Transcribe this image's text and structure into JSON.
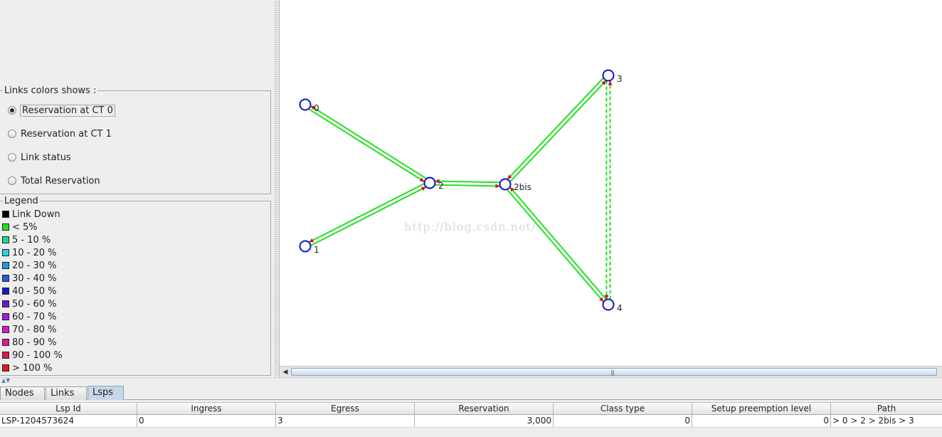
{
  "links_colors": {
    "title": "Links colors shows :",
    "options": [
      {
        "label": "Reservation at CT 0",
        "checked": true
      },
      {
        "label": "Reservation at CT 1",
        "checked": false
      },
      {
        "label": "Link status",
        "checked": false
      },
      {
        "label": "Total Reservation",
        "checked": false
      }
    ]
  },
  "legend": {
    "title": "Legend",
    "items": [
      {
        "label": "Link Down",
        "color": "#000000"
      },
      {
        "label": "< 5%",
        "color": "#22e022"
      },
      {
        "label": "5 - 10 %",
        "color": "#1fd890"
      },
      {
        "label": "10 - 20 %",
        "color": "#22d8e6"
      },
      {
        "label": "20 - 30 %",
        "color": "#1e9ae0"
      },
      {
        "label": "30 - 40 %",
        "color": "#1a5ee6"
      },
      {
        "label": "40 - 50 %",
        "color": "#1818c8"
      },
      {
        "label": "50 - 60 %",
        "color": "#6a18d8"
      },
      {
        "label": "60 - 70 %",
        "color": "#a818e0"
      },
      {
        "label": "70 - 80 %",
        "color": "#d818d0"
      },
      {
        "label": "80 - 90 %",
        "color": "#e0189a"
      },
      {
        "label": "90 - 100 %",
        "color": "#e01850"
      },
      {
        "label": "> 100 %",
        "color": "#e81818"
      }
    ]
  },
  "graph": {
    "node_color": "#1010d0",
    "link_color": "#22e022",
    "arrow_color": "#d01010",
    "nodes": [
      {
        "id": "0",
        "label": "0"
      },
      {
        "id": "1",
        "label": "1"
      },
      {
        "id": "2",
        "label": "2"
      },
      {
        "id": "2bis",
        "label": "2bis"
      },
      {
        "id": "3",
        "label": "3"
      },
      {
        "id": "4",
        "label": "4"
      }
    ],
    "links": [
      {
        "from": "0",
        "to": "2",
        "style": "solid"
      },
      {
        "from": "1",
        "to": "2",
        "style": "solid"
      },
      {
        "from": "2",
        "to": "2bis",
        "style": "solid"
      },
      {
        "from": "2bis",
        "to": "3",
        "style": "solid"
      },
      {
        "from": "2bis",
        "to": "4",
        "style": "solid"
      },
      {
        "from": "3",
        "to": "4",
        "style": "dashed"
      }
    ],
    "watermark": "http://blog.csdn.net/"
  },
  "tabs": [
    "Nodes",
    "Links",
    "Lsps"
  ],
  "active_tab": "Lsps",
  "table": {
    "columns": [
      "Lsp Id",
      "Ingress",
      "Egress",
      "Reservation",
      "Class type",
      "Setup preemption level",
      "Path"
    ],
    "rows": [
      [
        "LSP-1204573624",
        "0",
        "3",
        "3,000",
        "0",
        "0",
        "> 0 > 2 > 2bis > 3"
      ]
    ]
  }
}
